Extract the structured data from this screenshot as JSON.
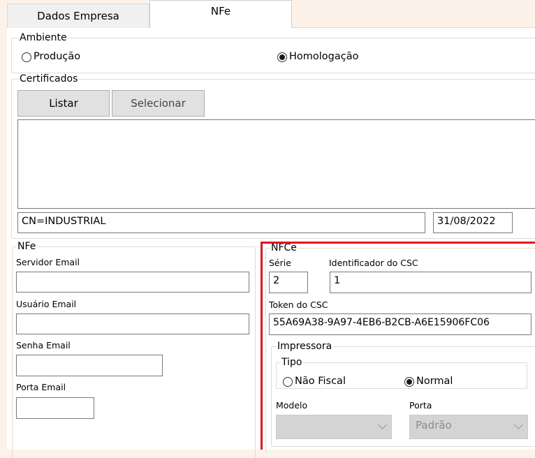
{
  "tabs": [
    {
      "label": "Dados Empresa",
      "active": false
    },
    {
      "label": "NFe",
      "active": true
    }
  ],
  "ambiente": {
    "legend": "Ambiente",
    "options": [
      {
        "label": "Produção",
        "selected": false
      },
      {
        "label": "Homologação",
        "selected": true
      }
    ]
  },
  "certificados": {
    "legend": "Certificados",
    "listar_label": "Listar",
    "selecionar_label": "Selecionar",
    "cn_value": "CN=INDUSTRIAL",
    "date_value": "31/08/2022"
  },
  "nfe": {
    "legend": "NFe",
    "servidor_email_label": "Servidor Email",
    "servidor_email_value": "",
    "usuario_email_label": "Usuário Email",
    "usuario_email_value": "",
    "senha_email_label": "Senha Email",
    "senha_email_value": "",
    "porta_email_label": "Porta Email",
    "porta_email_value": ""
  },
  "nfce": {
    "legend": "NFCe",
    "serie_label": "Série",
    "serie_value": "2",
    "csc_id_label": "Identificador do CSC",
    "csc_id_value": "1",
    "token_label": "Token do CSC",
    "token_value": "55A69A38-9A97-4EB6-B2CB-A6E15906FC06",
    "highlight_color": "#e0141e",
    "impressora": {
      "legend": "Impressora",
      "tipo_legend": "Tipo",
      "tipo_options": [
        {
          "label": "Não Fiscal",
          "selected": false
        },
        {
          "label": "Normal",
          "selected": true
        }
      ],
      "modelo_label": "Modelo",
      "modelo_value": "",
      "porta_label": "Porta",
      "porta_value": "Padrão"
    }
  },
  "colors": {
    "background": "#fdf2ea",
    "button_bg": "#e1e1e1",
    "disabled_combo_bg": "#d4d4d4"
  }
}
